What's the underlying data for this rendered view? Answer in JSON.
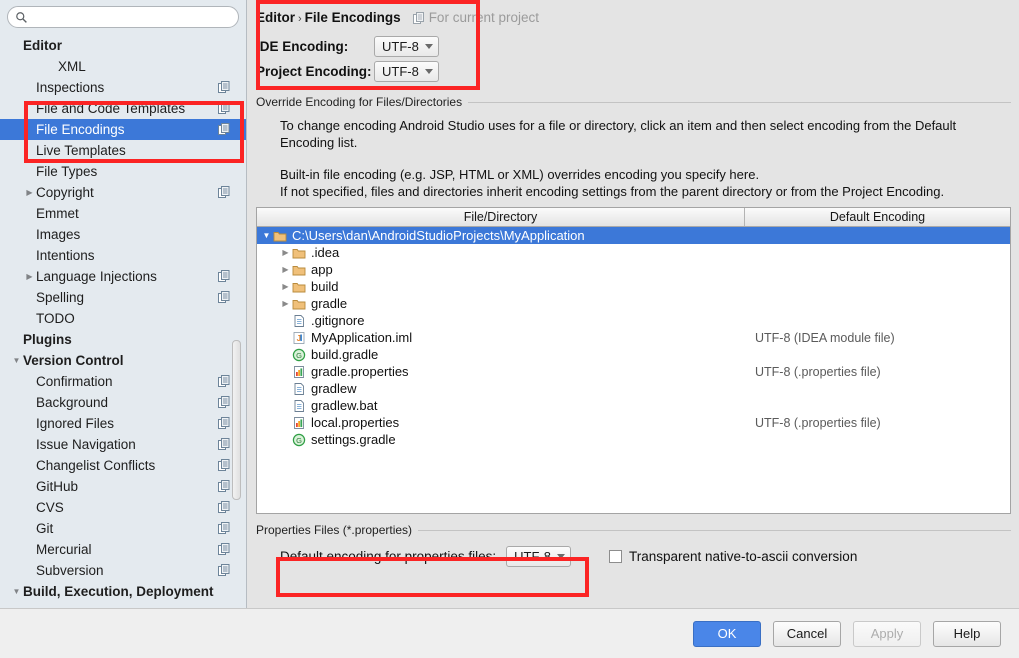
{
  "search": {
    "value": "",
    "placeholder": "",
    "icon": "search-icon"
  },
  "sidebar": {
    "items": [
      {
        "label": "Editor",
        "indent": 0,
        "bold": true,
        "arrow": "",
        "copy": false,
        "selected": false
      },
      {
        "label": "XML",
        "indent": 2,
        "bold": false,
        "arrow": "",
        "copy": false,
        "selected": false
      },
      {
        "label": "Inspections",
        "indent": 1,
        "bold": false,
        "arrow": "",
        "copy": true,
        "selected": false
      },
      {
        "label": "File and Code Templates",
        "indent": 1,
        "bold": false,
        "arrow": "",
        "copy": true,
        "selected": false
      },
      {
        "label": "File Encodings",
        "indent": 1,
        "bold": false,
        "arrow": "",
        "copy": true,
        "selected": true
      },
      {
        "label": "Live Templates",
        "indent": 1,
        "bold": false,
        "arrow": "",
        "copy": false,
        "selected": false
      },
      {
        "label": "File Types",
        "indent": 1,
        "bold": false,
        "arrow": "",
        "copy": false,
        "selected": false
      },
      {
        "label": "Copyright",
        "indent": 1,
        "bold": false,
        "arrow": "▶",
        "copy": true,
        "selected": false
      },
      {
        "label": "Emmet",
        "indent": 1,
        "bold": false,
        "arrow": "",
        "copy": false,
        "selected": false
      },
      {
        "label": "Images",
        "indent": 1,
        "bold": false,
        "arrow": "",
        "copy": false,
        "selected": false
      },
      {
        "label": "Intentions",
        "indent": 1,
        "bold": false,
        "arrow": "",
        "copy": false,
        "selected": false
      },
      {
        "label": "Language Injections",
        "indent": 1,
        "bold": false,
        "arrow": "▶",
        "copy": true,
        "selected": false
      },
      {
        "label": "Spelling",
        "indent": 1,
        "bold": false,
        "arrow": "",
        "copy": true,
        "selected": false
      },
      {
        "label": "TODO",
        "indent": 1,
        "bold": false,
        "arrow": "",
        "copy": false,
        "selected": false
      },
      {
        "label": "Plugins",
        "indent": 0,
        "bold": true,
        "arrow": "",
        "copy": false,
        "selected": false
      },
      {
        "label": "Version Control",
        "indent": 0,
        "bold": true,
        "arrow": "▼",
        "copy": false,
        "selected": false
      },
      {
        "label": "Confirmation",
        "indent": 1,
        "bold": false,
        "arrow": "",
        "copy": true,
        "selected": false
      },
      {
        "label": "Background",
        "indent": 1,
        "bold": false,
        "arrow": "",
        "copy": true,
        "selected": false
      },
      {
        "label": "Ignored Files",
        "indent": 1,
        "bold": false,
        "arrow": "",
        "copy": true,
        "selected": false
      },
      {
        "label": "Issue Navigation",
        "indent": 1,
        "bold": false,
        "arrow": "",
        "copy": true,
        "selected": false
      },
      {
        "label": "Changelist Conflicts",
        "indent": 1,
        "bold": false,
        "arrow": "",
        "copy": true,
        "selected": false
      },
      {
        "label": "GitHub",
        "indent": 1,
        "bold": false,
        "arrow": "",
        "copy": true,
        "selected": false
      },
      {
        "label": "CVS",
        "indent": 1,
        "bold": false,
        "arrow": "",
        "copy": true,
        "selected": false
      },
      {
        "label": "Git",
        "indent": 1,
        "bold": false,
        "arrow": "",
        "copy": true,
        "selected": false
      },
      {
        "label": "Mercurial",
        "indent": 1,
        "bold": false,
        "arrow": "",
        "copy": true,
        "selected": false
      },
      {
        "label": "Subversion",
        "indent": 1,
        "bold": false,
        "arrow": "",
        "copy": true,
        "selected": false
      },
      {
        "label": "Build, Execution, Deployment",
        "indent": 0,
        "bold": true,
        "arrow": "▼",
        "copy": false,
        "selected": false
      }
    ]
  },
  "header": {
    "breadcrumb_root": "Editor",
    "breadcrumb_sep": "›",
    "breadcrumb_leaf": "File Encodings",
    "scope_label": "For current project",
    "scope_icon": "module-copy-icon"
  },
  "encoding": {
    "ide_label": "IDE Encoding:",
    "ide_value": "UTF-8",
    "project_label": "Project Encoding:",
    "project_value": "UTF-8"
  },
  "override": {
    "group_title": "Override Encoding for Files/Directories",
    "para1": "To change encoding Android Studio uses for a file or directory, click an item and then select encoding from the Default Encoding list.",
    "para2": "Built-in file encoding (e.g. JSP, HTML or XML) overrides encoding you specify here.",
    "para3": "If not specified, files and directories inherit encoding settings from the parent directory or from the Project Encoding."
  },
  "table": {
    "columns": [
      "File/Directory",
      "Default Encoding"
    ],
    "rows": [
      {
        "name": "C:\\Users\\dan\\AndroidStudioProjects\\MyApplication",
        "encoding": "",
        "icon": "folder-icon",
        "arrow": "▼",
        "level": 0,
        "selected": true
      },
      {
        "name": ".idea",
        "encoding": "",
        "icon": "folder-icon",
        "arrow": "▶",
        "level": 1,
        "selected": false
      },
      {
        "name": "app",
        "encoding": "",
        "icon": "folder-icon",
        "arrow": "▶",
        "level": 1,
        "selected": false
      },
      {
        "name": "build",
        "encoding": "",
        "icon": "folder-icon",
        "arrow": "▶",
        "level": 1,
        "selected": false
      },
      {
        "name": "gradle",
        "encoding": "",
        "icon": "folder-icon",
        "arrow": "▶",
        "level": 1,
        "selected": false
      },
      {
        "name": ".gitignore",
        "encoding": "",
        "icon": "file-icon",
        "arrow": "",
        "level": 1,
        "selected": false
      },
      {
        "name": "MyApplication.iml",
        "encoding": "UTF-8 (IDEA module file)",
        "icon": "iml-icon",
        "arrow": "",
        "level": 1,
        "selected": false
      },
      {
        "name": "build.gradle",
        "encoding": "",
        "icon": "gradle-icon",
        "arrow": "",
        "level": 1,
        "selected": false
      },
      {
        "name": "gradle.properties",
        "encoding": "UTF-8 (.properties file)",
        "icon": "properties-icon",
        "arrow": "",
        "level": 1,
        "selected": false
      },
      {
        "name": "gradlew",
        "encoding": "",
        "icon": "file-icon",
        "arrow": "",
        "level": 1,
        "selected": false
      },
      {
        "name": "gradlew.bat",
        "encoding": "",
        "icon": "file-icon",
        "arrow": "",
        "level": 1,
        "selected": false
      },
      {
        "name": "local.properties",
        "encoding": "UTF-8 (.properties file)",
        "icon": "properties-icon",
        "arrow": "",
        "level": 1,
        "selected": false
      },
      {
        "name": "settings.gradle",
        "encoding": "",
        "icon": "gradle-icon",
        "arrow": "",
        "level": 1,
        "selected": false
      }
    ]
  },
  "properties": {
    "group_title": "Properties Files (*.properties)",
    "default_enc_label": "Default encoding for properties files:",
    "default_enc_value": "UTF-8",
    "transparent_label": "Transparent native-to-ascii conversion",
    "transparent_checked": false
  },
  "buttons": {
    "ok": "OK",
    "cancel": "Cancel",
    "apply": "Apply",
    "help": "Help"
  },
  "colors": {
    "selection_blue": "#3c78d8",
    "primary_button": "#4a86e8",
    "annotation_red": "#fb2424",
    "sidebar_bg": "#e4eaef",
    "main_bg": "#e4e4e4"
  }
}
